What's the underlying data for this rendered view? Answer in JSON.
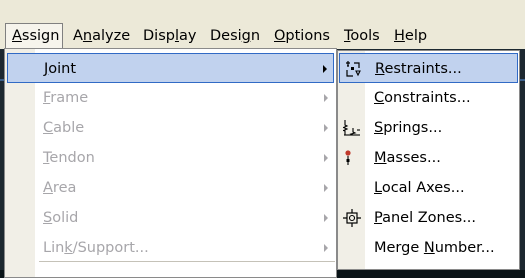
{
  "menubar": {
    "items": [
      {
        "pre": "",
        "u": "A",
        "post": "ssign"
      },
      {
        "pre": "A",
        "u": "n",
        "post": "alyze"
      },
      {
        "pre": "Disp",
        "u": "l",
        "post": "ay"
      },
      {
        "pre": "Desi",
        "u": "g",
        "post": "n"
      },
      {
        "pre": "",
        "u": "O",
        "post": "ptions"
      },
      {
        "pre": "",
        "u": "T",
        "post": "ools"
      },
      {
        "pre": "",
        "u": "H",
        "post": "elp"
      }
    ]
  },
  "assign_menu": {
    "items": [
      {
        "pre": "",
        "u": "J",
        "post": "oint",
        "enabled": true
      },
      {
        "pre": "",
        "u": "F",
        "post": "rame",
        "enabled": false
      },
      {
        "pre": "",
        "u": "C",
        "post": "able",
        "enabled": false
      },
      {
        "pre": "",
        "u": "T",
        "post": "endon",
        "enabled": false
      },
      {
        "pre": "",
        "u": "A",
        "post": "rea",
        "enabled": false
      },
      {
        "pre": "",
        "u": "S",
        "post": "olid",
        "enabled": false
      },
      {
        "pre": "Lin",
        "u": "k",
        "post": "/Support...",
        "enabled": false
      }
    ]
  },
  "joint_submenu": {
    "items": [
      {
        "pre": "",
        "u": "R",
        "post": "estraints...",
        "icon": "restraints-icon"
      },
      {
        "pre": "",
        "u": "C",
        "post": "onstraints...",
        "icon": ""
      },
      {
        "pre": "",
        "u": "S",
        "post": "prings...",
        "icon": "springs-icon"
      },
      {
        "pre": "",
        "u": "M",
        "post": "asses...",
        "icon": "masses-icon"
      },
      {
        "pre": "",
        "u": "L",
        "post": "ocal Axes...",
        "icon": ""
      },
      {
        "pre": "",
        "u": "P",
        "post": "anel Zones...",
        "icon": "panel-zones-icon"
      },
      {
        "pre": "Merge ",
        "u": "N",
        "post": "umber...",
        "icon": ""
      }
    ]
  },
  "colors": {
    "menu_bg": "#ece9d8",
    "highlight_fill": "#c1d2ee",
    "highlight_border": "#316ac5",
    "disabled_text": "#a7a6aa"
  }
}
